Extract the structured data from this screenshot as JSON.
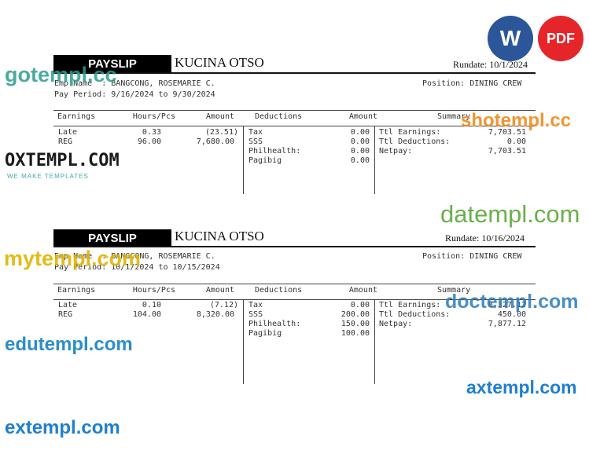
{
  "icons": {
    "word_label": "W",
    "pdf_label": "PDF",
    "word_color": "#2b579a",
    "pdf_color": "#e5252a"
  },
  "watermarks": [
    {
      "text": "gotempl.cc"
    },
    {
      "text": "OXTEMPL.COM",
      "sub": "WE MAKE TEMPLATES"
    },
    {
      "text": "shotempl.cc"
    },
    {
      "text": "datempl.com"
    },
    {
      "text": "mytempl.com"
    },
    {
      "text": "doctempl.com"
    },
    {
      "text": "edutempl.com"
    },
    {
      "text": "axtempl.com"
    },
    {
      "text": "extempl.com"
    }
  ],
  "payslips": [
    {
      "badge": "PAYSLIP",
      "company": "KUCINA OTSO",
      "rundate": "Rundate: 10/1/2024",
      "emp_name": "Emp Name  : BANGCONG, ROSEMARIE C.",
      "position": "Position: DINING CREW",
      "pay_period": "Pay Period: 9/16/2024 to 9/30/2024",
      "headers": {
        "earnings": "Earnings",
        "hours": "Hours/Pcs",
        "amount": "Amount",
        "deductions": "Deductions",
        "ded_amount": "Amount",
        "summary": "Summary"
      },
      "earnings": [
        {
          "label": "Late",
          "hours": "0.33",
          "amount": "(23.51)"
        },
        {
          "label": "REG",
          "hours": "96.00",
          "amount": "7,680.00"
        }
      ],
      "deductions": [
        {
          "label": "Tax",
          "amount": "0.00"
        },
        {
          "label": "SSS",
          "amount": "0.00"
        },
        {
          "label": "Philhealth:",
          "amount": "0.00"
        },
        {
          "label": "Pagibig",
          "amount": "0.00"
        }
      ],
      "summary": [
        {
          "label": "Ttl Earnings:",
          "amount": "7,703.51"
        },
        {
          "label": "Ttl Deductions:",
          "amount": "0.00"
        },
        {
          "label": "Netpay:",
          "amount": "7,703.51"
        }
      ]
    },
    {
      "badge": "PAYSLIP",
      "company": "KUCINA OTSO",
      "rundate": "Rundate: 10/16/2024",
      "emp_name": "Emp Name  : BANGCONG, ROSEMARIE C.",
      "position": "Position: DINING CREW",
      "pay_period": "Pay Period: 10/1/2024 to 10/15/2024",
      "headers": {
        "earnings": "Earnings",
        "hours": "Hours/Pcs",
        "amount": "Amount",
        "deductions": "Deductions",
        "ded_amount": "Amount",
        "summary": "Summary"
      },
      "earnings": [
        {
          "label": "Late",
          "hours": "0.10",
          "amount": "(7.12)"
        },
        {
          "label": "REG",
          "hours": "104.00",
          "amount": "8,320.00"
        }
      ],
      "deductions": [
        {
          "label": "Tax",
          "amount": "0.00"
        },
        {
          "label": "SSS",
          "amount": "200.00"
        },
        {
          "label": "Philhealth:",
          "amount": "150.00"
        },
        {
          "label": "Pagibig",
          "amount": "100.00"
        }
      ],
      "summary": [
        {
          "label": "Ttl Earnings:",
          "amount": "8,327.12"
        },
        {
          "label": "Ttl Deductions:",
          "amount": "450.00"
        },
        {
          "label": "Netpay:",
          "amount": "7,877.12"
        }
      ]
    }
  ]
}
